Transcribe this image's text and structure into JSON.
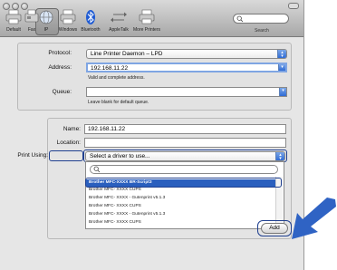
{
  "toolbar": {
    "items": [
      {
        "name": "default-tab",
        "label": "Default"
      },
      {
        "name": "fax-tab",
        "label": "Fax"
      },
      {
        "name": "ip-tab",
        "label": "IP"
      },
      {
        "name": "windows-tab",
        "label": "Windows"
      },
      {
        "name": "bluetooth-tab",
        "label": "Bluetooth"
      },
      {
        "name": "appletalk-tab",
        "label": "AppleTalk"
      },
      {
        "name": "more-printers-tab",
        "label": "More Printers"
      }
    ],
    "search_label": "Search",
    "selected": "IP"
  },
  "protocol": {
    "label": "Protocol:",
    "value": "Line Printer Daemon – LPD"
  },
  "address": {
    "label": "Address:",
    "value": "192.168.11.22",
    "hint": "Valid and complete address."
  },
  "queue": {
    "label": "Queue:",
    "value": "",
    "hint": "Leave blank for default queue."
  },
  "name": {
    "label": "Name:",
    "value": "192.168.11.22"
  },
  "location": {
    "label": "Location:",
    "value": ""
  },
  "print_using": {
    "label": "Print Using:",
    "value": "Select a driver to use..."
  },
  "driver_list": {
    "items": [
      "Brother MFC-XXXX BR-Script3",
      "Brother MFC- XXXX CUPS",
      "Brother MFC- XXXX - Gutenprint v5.1.3",
      "Brother MFC- XXXX CUPS",
      "Brother MFC- XXXX - Gutenprint v5.1.3",
      "Brother MFC- XXXX CUPS"
    ],
    "selected_index": 0
  },
  "add_button": {
    "label": "Add"
  },
  "colors": {
    "accent": "#2a5fbe",
    "highlight": "#1f3f8f",
    "arrow": "#2f63c4"
  }
}
